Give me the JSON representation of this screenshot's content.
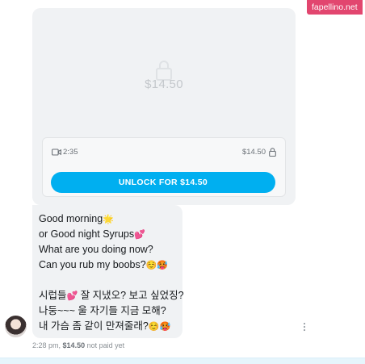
{
  "watermark": "fapellino.net",
  "locked_media": {
    "blurred_price": "$14.50",
    "duration": "2:35",
    "price": "$14.50",
    "unlock_label": "UNLOCK FOR $14.50",
    "accent_color": "#00aff0"
  },
  "message": {
    "lines": [
      "Good morning",
      "or Good night Syrups",
      "What are you doing now?",
      "Can you rub my boobs?",
      "시럽들",
      "잘 지냈오? 보고 싶었징?",
      "나둥~~~ 울 자기들 지금 모해?",
      "내 가슴 좀 같이 만져줄래?"
    ],
    "emojis": {
      "sun": "🌟",
      "hearts": "💕",
      "smile": "☺️",
      "flushed": "🥵"
    }
  },
  "status": {
    "time": "2:28 pm,",
    "price": "$14.50",
    "payment": "not paid yet"
  }
}
